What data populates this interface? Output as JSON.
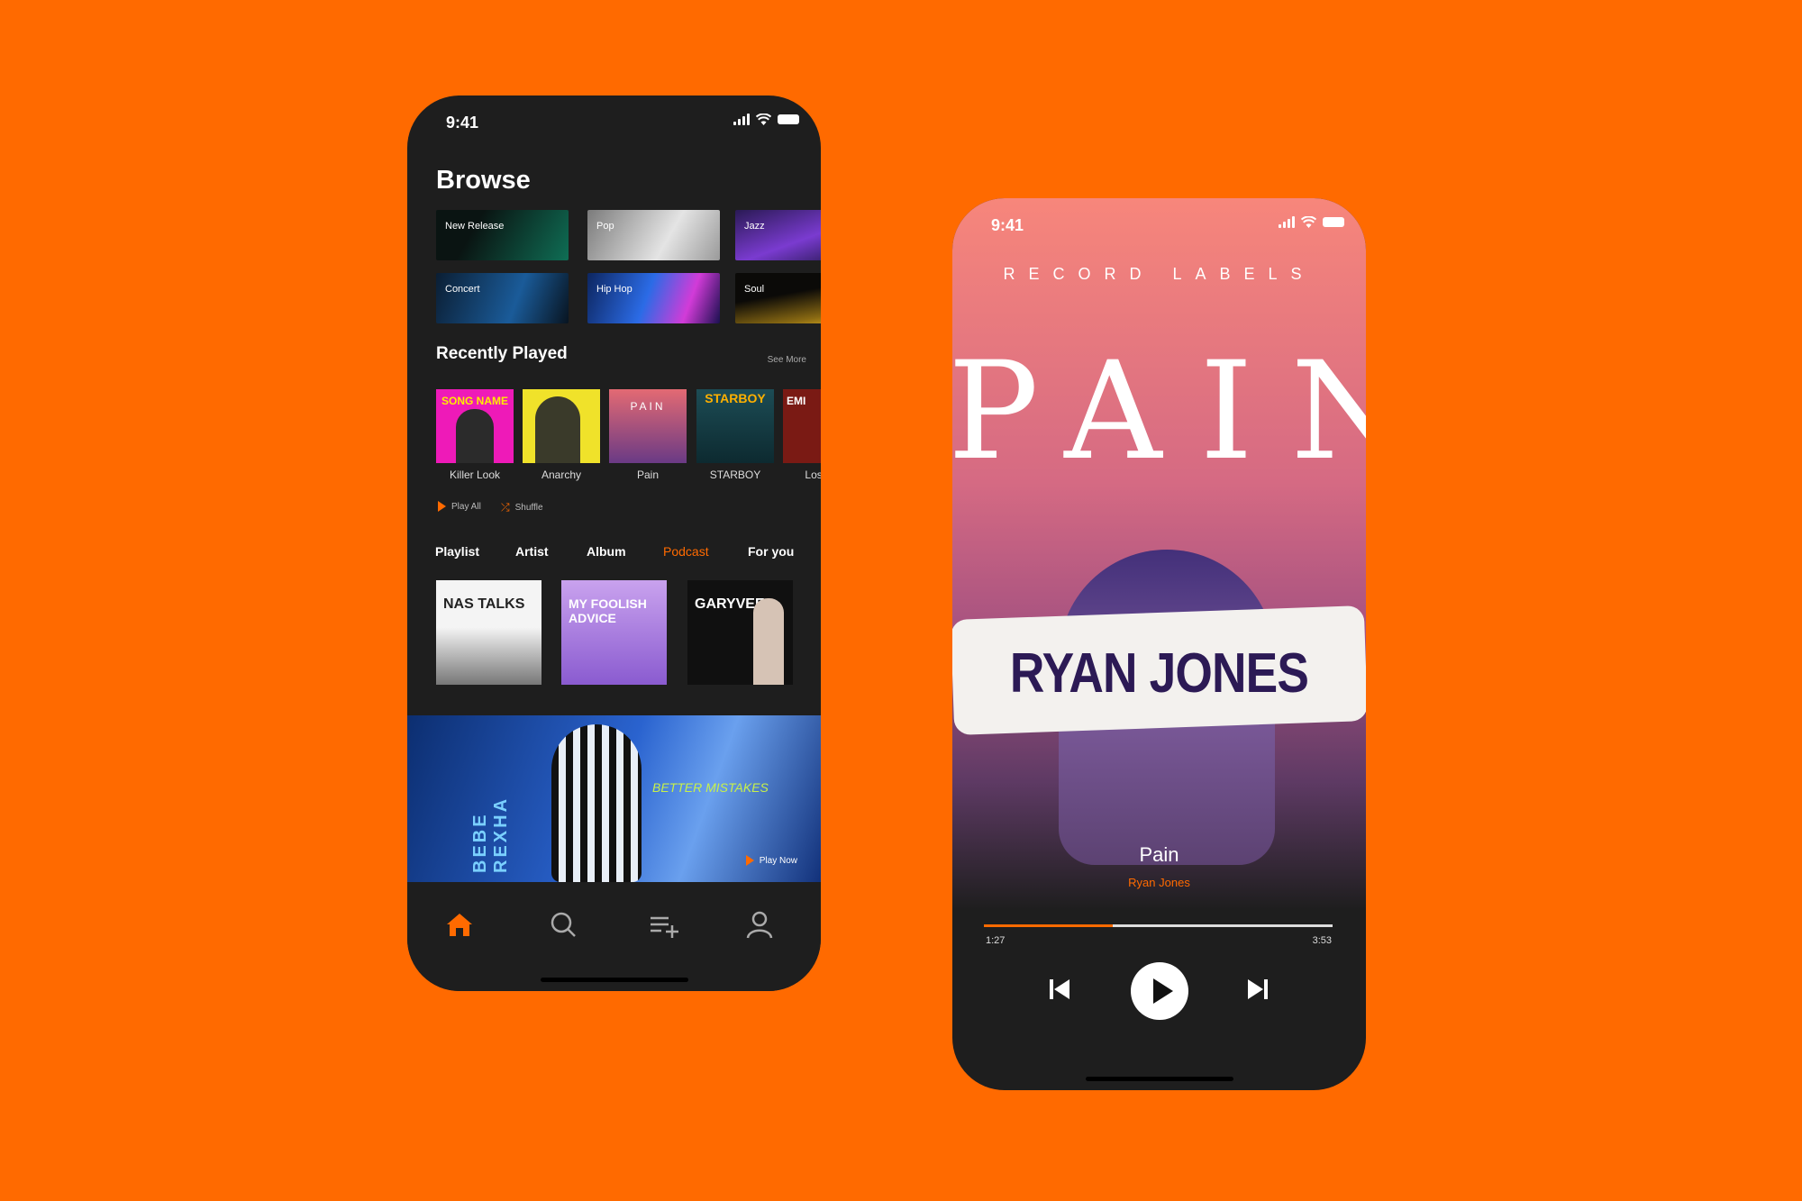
{
  "browse_screen": {
    "status": {
      "time": "9:41"
    },
    "heading": "Browse",
    "genres": [
      "New Release",
      "Pop",
      "Jazz",
      "Concert",
      "Hip Hop",
      "Soul"
    ],
    "recent": {
      "heading": "Recently Played",
      "see_more": "See More",
      "albums": [
        {
          "title": "Killer Look",
          "cover_text": "SONG NAME"
        },
        {
          "title": "Anarchy",
          "cover_text": ""
        },
        {
          "title": "Pain",
          "cover_text": "PAIN"
        },
        {
          "title": "STARBOY",
          "cover_text": "STARBOY"
        },
        {
          "title": "Lose Y",
          "cover_text": "EMI"
        }
      ],
      "play_all": "Play All",
      "shuffle": "Shuffle"
    },
    "tabs": [
      "Playlist",
      "Artist",
      "Album",
      "Podcast",
      "For you"
    ],
    "active_tab": "Podcast",
    "podcasts": [
      {
        "cover_text": "NAS TALKS"
      },
      {
        "cover_text": "MY FOOLISH ADVICE"
      },
      {
        "cover_text": "GARYVEE"
      }
    ],
    "banner": {
      "artist": "BEBE REXHA",
      "album": "BETTER MISTAKES",
      "play_now": "Play Now"
    },
    "nav": [
      "home-icon",
      "search-icon",
      "playlist-add-icon",
      "profile-icon"
    ]
  },
  "player_screen": {
    "status": {
      "time": "9:41"
    },
    "label": "RECORD LABELS",
    "art_word": "PAIN",
    "art_name": "RYAN JONES",
    "track": {
      "title": "Pain",
      "artist": "Ryan Jones"
    },
    "progress": {
      "current": "1:27",
      "total": "3:53",
      "fraction": 0.37
    },
    "controls": [
      "previous-icon",
      "play-icon",
      "next-icon"
    ]
  },
  "colors": {
    "accent": "#ff6a00",
    "background": "#ff6a00",
    "phone": "#1e1e1e"
  }
}
